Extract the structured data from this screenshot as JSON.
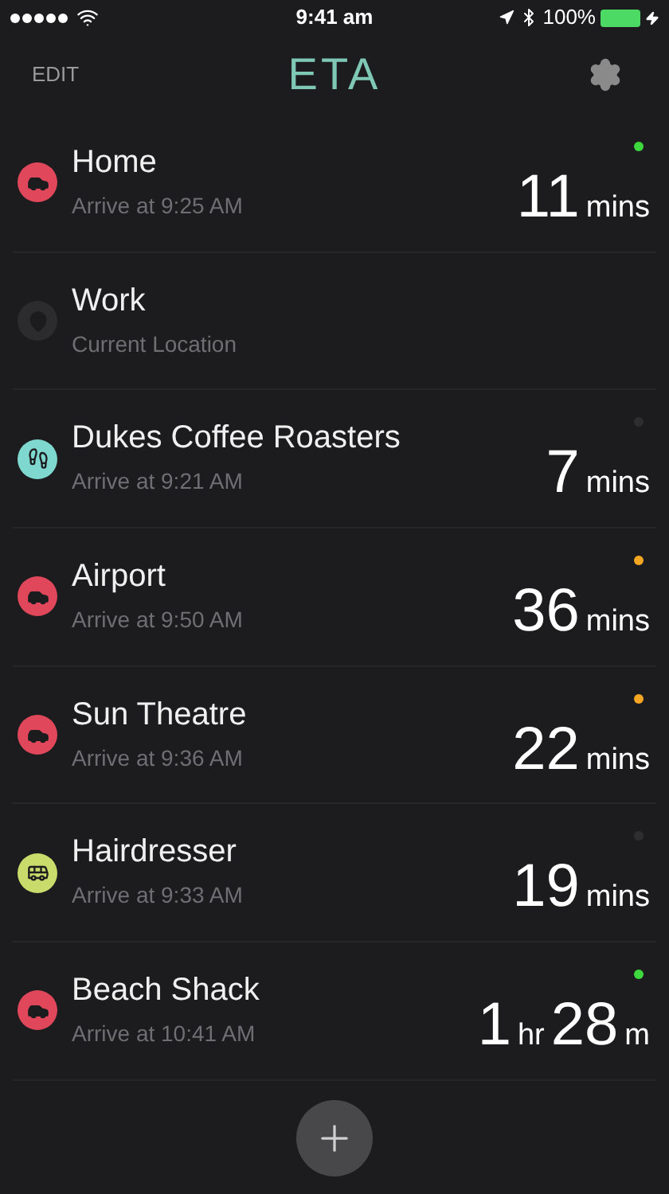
{
  "status_bar": {
    "time": "9:41 am",
    "battery": "100%"
  },
  "nav": {
    "edit": "EDIT",
    "title": "ETA"
  },
  "destinations": [
    {
      "name": "Home",
      "subtitle": "Arrive at 9:25 AM",
      "mode": {
        "kind": "car",
        "color": "#e0475a"
      },
      "status": {
        "color": "#3ed83e"
      },
      "eta": [
        {
          "value": "11",
          "unit": "mins"
        }
      ]
    },
    {
      "name": "Work",
      "subtitle": "Current Location",
      "mode": {
        "kind": "pin",
        "color": "#2c2c2e"
      }
    },
    {
      "name": "Dukes Coffee Roasters",
      "subtitle": "Arrive at 9:21 AM",
      "mode": {
        "kind": "walk",
        "color": "#7fd8d0"
      },
      "status": {
        "color": "#2e2e30"
      },
      "eta": [
        {
          "value": "7",
          "unit": "mins"
        }
      ]
    },
    {
      "name": "Airport",
      "subtitle": "Arrive at 9:50 AM",
      "mode": {
        "kind": "car",
        "color": "#e0475a"
      },
      "status": {
        "color": "#f5a623"
      },
      "eta": [
        {
          "value": "36",
          "unit": "mins"
        }
      ]
    },
    {
      "name": "Sun Theatre",
      "subtitle": "Arrive at 9:36 AM",
      "mode": {
        "kind": "car",
        "color": "#e0475a"
      },
      "status": {
        "color": "#f5a623"
      },
      "eta": [
        {
          "value": "22",
          "unit": "mins"
        }
      ]
    },
    {
      "name": "Hairdresser",
      "subtitle": "Arrive at 9:33 AM",
      "mode": {
        "kind": "bus",
        "color": "#c9dc6b"
      },
      "status": {
        "color": "#2e2e30"
      },
      "eta": [
        {
          "value": "19",
          "unit": "mins"
        }
      ]
    },
    {
      "name": "Beach Shack",
      "subtitle": "Arrive at 10:41 AM",
      "mode": {
        "kind": "car",
        "color": "#e0475a"
      },
      "status": {
        "color": "#3ed83e"
      },
      "eta": [
        {
          "value": "1",
          "unit": "hr"
        },
        {
          "value": "28",
          "unit": "m"
        }
      ]
    }
  ]
}
